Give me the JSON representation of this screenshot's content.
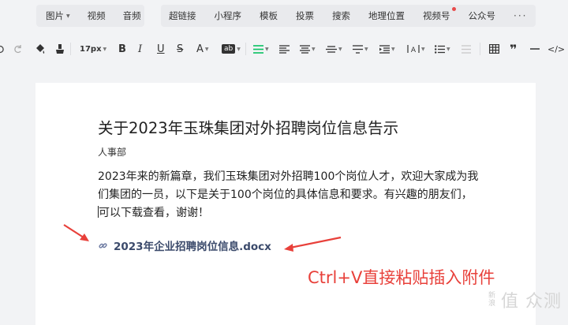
{
  "insert_toolbar": {
    "left_items": [
      {
        "label": "图片",
        "has_dropdown": true
      },
      {
        "label": "视频"
      },
      {
        "label": "音频"
      }
    ],
    "right_items": [
      {
        "label": "超链接"
      },
      {
        "label": "小程序"
      },
      {
        "label": "模板"
      },
      {
        "label": "投票"
      },
      {
        "label": "搜索"
      },
      {
        "label": "地理位置"
      },
      {
        "label": "视频号",
        "has_badge": true
      },
      {
        "label": "公众号"
      }
    ],
    "more_label": "···"
  },
  "format_toolbar": {
    "font_size": "17px",
    "bold": "B",
    "italic": "I",
    "underline": "U",
    "strike": "S",
    "font_color": "A",
    "bg_color": "ab",
    "accent_color": "#07c160",
    "quote": "❞",
    "code": "</>"
  },
  "document": {
    "title": "关于2023年玉珠集团对外招聘岗位信息告示",
    "author": "人事部",
    "body_lines": [
      "2023年来的新篇章，我们玉珠集团对外招聘100个岗位人才，欢迎大家成为我",
      "们集团的一员，以下是关于100个岗位的具体信息和要求。有兴趣的朋友们，",
      "可以下载查看，谢谢！"
    ],
    "attachment_name": "2023年企业招聘岗位信息.docx"
  },
  "annotation": {
    "text": "Ctrl+V直接粘贴插入附件",
    "color": "#e8403a"
  },
  "watermark": {
    "small": "新浪",
    "big": "值 众测"
  }
}
